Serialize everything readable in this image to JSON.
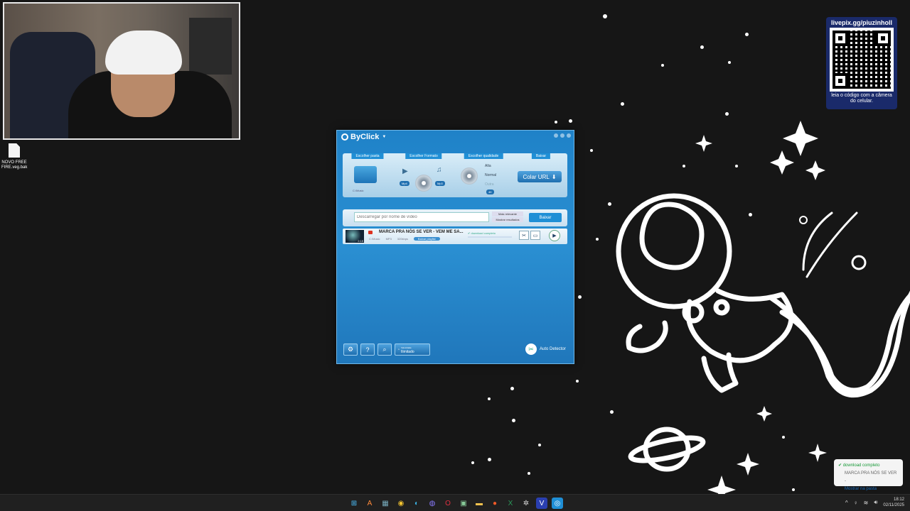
{
  "desktop": {
    "file_icon_label": "NOVO FREE FIRE.veg.bak"
  },
  "overlay": {
    "qr_title": "livepix.gg/piuzinholl",
    "qr_caption": "leia o código com a câmera do celular."
  },
  "app": {
    "title": "ByClick",
    "steps": {
      "folder_label": "Escolher pasta",
      "folder_path": "C:\\Music",
      "format_label": "Escolher Formato",
      "format_left": "Mp4",
      "format_right": "Mp3",
      "quality_label": "Escolher qualidade",
      "quality_options": [
        "Alta",
        "Normal",
        "Outra"
      ],
      "quality_badge": "4K",
      "download_label": "Baixar",
      "paste_button": "Colar URL"
    },
    "search": {
      "placeholder": "Descarregar por nome de vídeo",
      "option_relevant": "Mais relevante",
      "option_show": "Mostrar resultados",
      "button": "Baixar"
    },
    "download_item": {
      "title": "MARCA PRA NÓS SE VER - VEM ME SA...",
      "duration": "2:19",
      "path": "C:\\Music",
      "format": "MP3",
      "bitrate": "320kbps",
      "playlist_button": "Baixar playlist",
      "status": "download completo"
    },
    "footer": {
      "speed_top": "Velocidade",
      "speed_bottom": "Ilimitado",
      "auto_detector": "Auto Detector"
    }
  },
  "toast": {
    "status": "download completo",
    "title": "MARCA PRA NÓS SE VER -",
    "action": "Mostrar na pasta"
  },
  "taskbar": {
    "time": "18:12",
    "date": "02/11/2025"
  }
}
